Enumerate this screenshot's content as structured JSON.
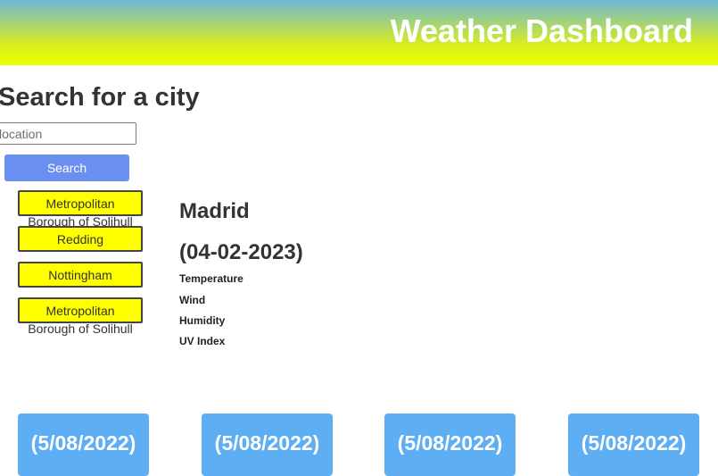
{
  "header": {
    "title": "Weather Dashboard"
  },
  "search": {
    "heading": "Search for a city",
    "placeholder": "location",
    "button_label": "Search"
  },
  "history": [
    {
      "line1": "Metropolitan",
      "line2": "Borough of Solihull"
    },
    {
      "line1": "Redding",
      "line2": ""
    },
    {
      "line1": "Nottingham",
      "line2": ""
    },
    {
      "line1": "Metropolitan",
      "line2": "Borough of Solihull"
    }
  ],
  "current": {
    "city": "Madrid",
    "date": "(04-02-2023)",
    "stats": {
      "temperature": "Temperature",
      "wind": "Wind",
      "humidity": "Humidity",
      "uv_index": "UV Index"
    }
  },
  "forecast": [
    {
      "date": "(5/08/2022)"
    },
    {
      "date": "(5/08/2022)"
    },
    {
      "date": "(5/08/2022)"
    },
    {
      "date": "(5/08/2022)"
    }
  ],
  "colors": {
    "header_gradient_top": "#6fb8d6",
    "header_gradient_bottom": "#eaff00",
    "search_button": "#6a8ff0",
    "history_button": "#ffff00",
    "forecast_card": "#5eaef4"
  }
}
